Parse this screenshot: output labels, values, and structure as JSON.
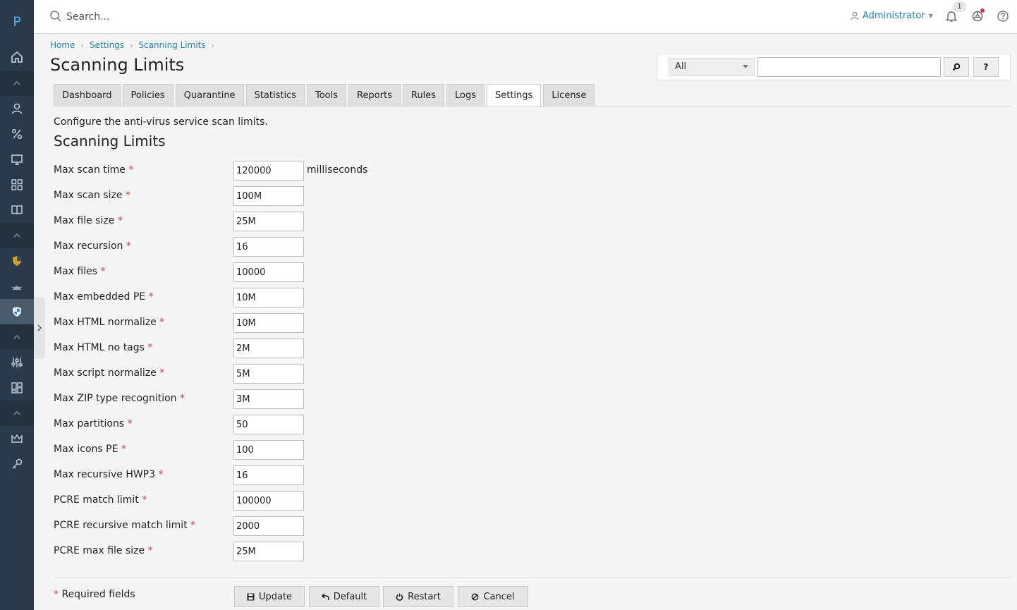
{
  "app": {
    "logo_letter": "P"
  },
  "header": {
    "search_placeholder": "Search...",
    "user_name": "Administrator",
    "notification_count": "1"
  },
  "breadcrumb": [
    "Home",
    "Settings",
    "Scanning Limits"
  ],
  "page": {
    "title": "Scanning Limits",
    "description": "Configure the anti-virus service scan limits.",
    "section_title": "Scanning Limits"
  },
  "filter": {
    "selected": "All",
    "search_btn": "⌕",
    "help_btn": "?"
  },
  "tabs": [
    "Dashboard",
    "Policies",
    "Quarantine",
    "Statistics",
    "Tools",
    "Reports",
    "Rules",
    "Logs",
    "Settings",
    "License"
  ],
  "active_tab": "Settings",
  "fields": [
    {
      "label": "Max scan time",
      "value": "120000",
      "unit": "milliseconds"
    },
    {
      "label": "Max scan size",
      "value": "100M"
    },
    {
      "label": "Max file size",
      "value": "25M"
    },
    {
      "label": "Max recursion",
      "value": "16"
    },
    {
      "label": "Max files",
      "value": "10000"
    },
    {
      "label": "Max embedded PE",
      "value": "10M"
    },
    {
      "label": "Max HTML normalize",
      "value": "10M"
    },
    {
      "label": "Max HTML no tags",
      "value": "2M"
    },
    {
      "label": "Max script normalize",
      "value": "5M"
    },
    {
      "label": "Max ZIP type recognition",
      "value": "3M"
    },
    {
      "label": "Max partitions",
      "value": "50"
    },
    {
      "label": "Max icons PE",
      "value": "100"
    },
    {
      "label": "Max recursive HWP3",
      "value": "16"
    },
    {
      "label": "PCRE match limit",
      "value": "100000"
    },
    {
      "label": "PCRE recursive match limit",
      "value": "2000"
    },
    {
      "label": "PCRE max file size",
      "value": "25M"
    }
  ],
  "footer": {
    "required_mark": "*",
    "required_text": "Required fields",
    "buttons": [
      {
        "label": "Update",
        "icon": "save-icon"
      },
      {
        "label": "Default",
        "icon": "undo-icon"
      },
      {
        "label": "Restart",
        "icon": "power-icon"
      },
      {
        "label": "Cancel",
        "icon": "cancel-icon"
      }
    ]
  },
  "colors": {
    "sidebar": "#2b3a4a",
    "link": "#1f7fb5",
    "required": "#d43a48"
  }
}
